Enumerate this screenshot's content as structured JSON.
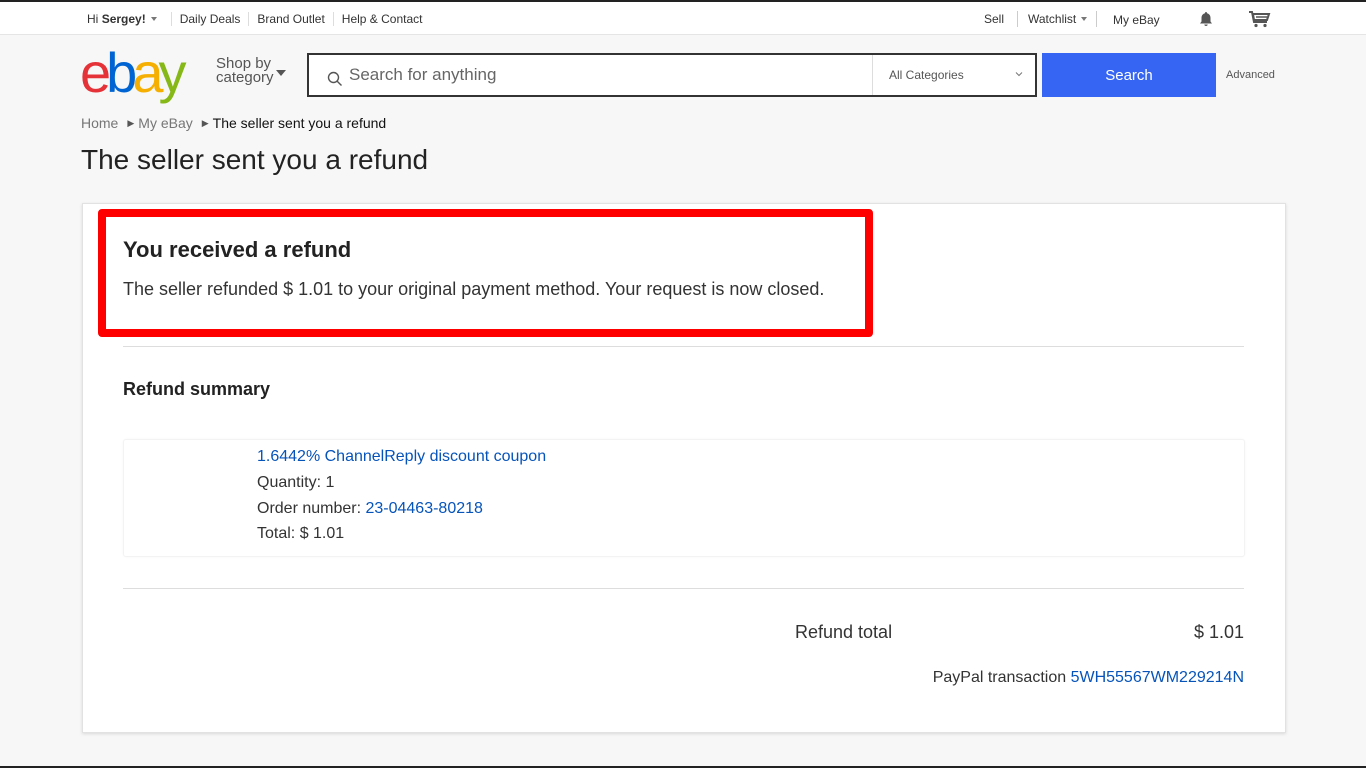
{
  "topbar": {
    "greeting_prefix": "Hi ",
    "user_name": "Sergey!",
    "links": [
      "Daily Deals",
      "Brand Outlet",
      "Help & Contact"
    ],
    "sell": "Sell",
    "watchlist": "Watchlist",
    "my_ebay": "My eBay",
    "icons": {
      "notifications": "bell-icon",
      "cart": "cart-icon"
    }
  },
  "header": {
    "logo_letters": [
      {
        "char": "e",
        "color": "#e53238"
      },
      {
        "char": "b",
        "color": "#0064d2"
      },
      {
        "char": "a",
        "color": "#f5af02"
      },
      {
        "char": "y",
        "color": "#86b817"
      }
    ],
    "shop_by_line1": "Shop by",
    "shop_by_line2": "category",
    "search": {
      "placeholder": "Search for anything",
      "value": "",
      "category": "All Categories",
      "button_label": "Search",
      "button_color": "#3665f3"
    },
    "advanced": "Advanced"
  },
  "breadcrumb": {
    "items": [
      "Home",
      "My eBay"
    ],
    "current": "The seller sent you a refund"
  },
  "page_title": "The seller sent you a refund",
  "refund_notice": {
    "heading": "You received a refund",
    "message": "The seller refunded $ 1.01 to your original payment method. Your request is now closed.",
    "highlight_color": "#ff0000"
  },
  "summary": {
    "heading": "Refund summary",
    "item": {
      "title": "1.6442% ChannelReply discount coupon",
      "quantity_label": "Quantity: ",
      "quantity": "1",
      "order_label": "Order number: ",
      "order_number": "23-04463-80218",
      "total_label": "Total: ",
      "total": "$ 1.01"
    },
    "refund_total_label": "Refund total",
    "refund_total_value": "$ 1.01",
    "paypal_label": "PayPal transaction ",
    "paypal_id": "5WH55567WM229214N"
  }
}
